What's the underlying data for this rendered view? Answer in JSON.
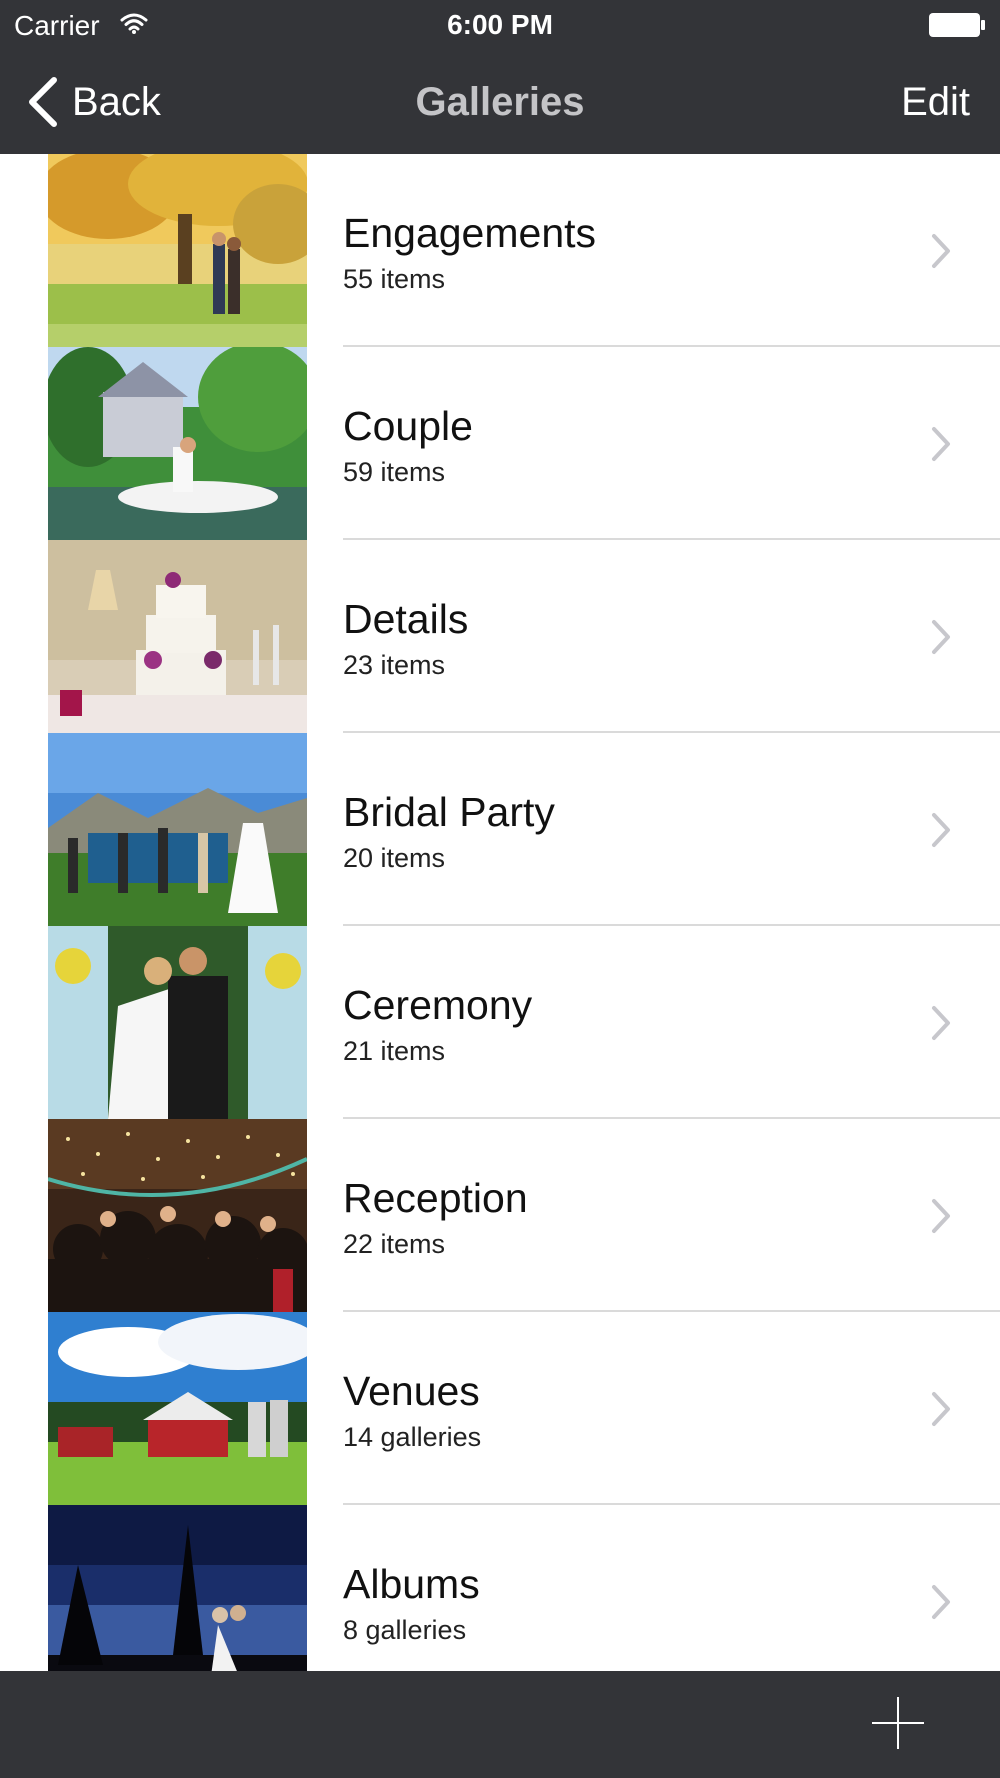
{
  "status_bar": {
    "carrier": "Carrier",
    "time": "6:00 PM",
    "wifi_icon": "wifi-icon",
    "battery_icon": "battery-full-icon"
  },
  "nav": {
    "back_label": "Back",
    "back_icon": "chevron-left-icon",
    "title": "Galleries",
    "edit_label": "Edit"
  },
  "galleries": [
    {
      "title": "Engagements",
      "subtitle": "55 items",
      "thumbnail": "couple in autumn park"
    },
    {
      "title": "Couple",
      "subtitle": "59 items",
      "thumbnail": "couple kissing in rowboat by victorian house"
    },
    {
      "title": "Details",
      "subtitle": "23 items",
      "thumbnail": "wedding cake with purple flowers"
    },
    {
      "title": "Bridal Party",
      "subtitle": "20 items",
      "thumbnail": "wedding party by vintage blue truck"
    },
    {
      "title": "Ceremony",
      "subtitle": "21 items",
      "thumbnail": "couple kissing under floral arch"
    },
    {
      "title": "Reception",
      "subtitle": "22 items",
      "thumbnail": "dancing crowd in barn with string lights"
    },
    {
      "title": "Venues",
      "subtitle": "14 galleries",
      "thumbnail": "red barn with silos under blue sky"
    },
    {
      "title": "Albums",
      "subtitle": "8 galleries",
      "thumbnail": "couple silhouette at dusk"
    }
  ],
  "row_chevron_icon": "chevron-right-icon",
  "toolbar": {
    "add_icon": "plus-icon"
  },
  "colors": {
    "bar_background": "#333438",
    "bar_text": "#ffffff",
    "title_text": "#c4c4c7",
    "separator": "#dadada",
    "chevron": "#c7c7cc"
  }
}
